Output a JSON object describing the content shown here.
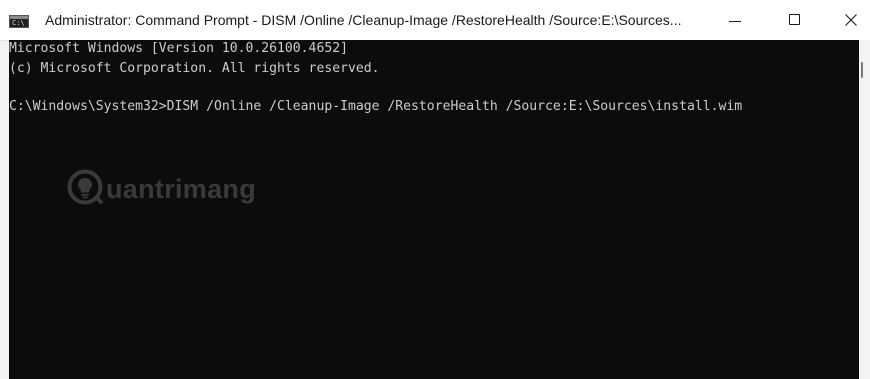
{
  "window": {
    "title": "Administrator: Command Prompt - DISM  /Online /Cleanup-Image /RestoreHealth /Source:E:\\Sources...",
    "icon": "command-prompt-icon",
    "icon_glyph": "C:\\",
    "controls": {
      "minimize": "minimize-icon",
      "maximize": "maximize-icon",
      "close": "close-icon"
    }
  },
  "console": {
    "lines": [
      "Microsoft Windows [Version 10.0.26100.4652]",
      "(c) Microsoft Corporation. All rights reserved.",
      "C:\\Windows\\System32>DISM /Online /Cleanup-Image /RestoreHealth /Source:E:\\Sources\\install.wim"
    ],
    "background_color": "#0c0c0c",
    "text_color": "#cccccc"
  },
  "watermark": {
    "text": "uantrimang",
    "logo": "quantrimang-bulb-logo"
  }
}
